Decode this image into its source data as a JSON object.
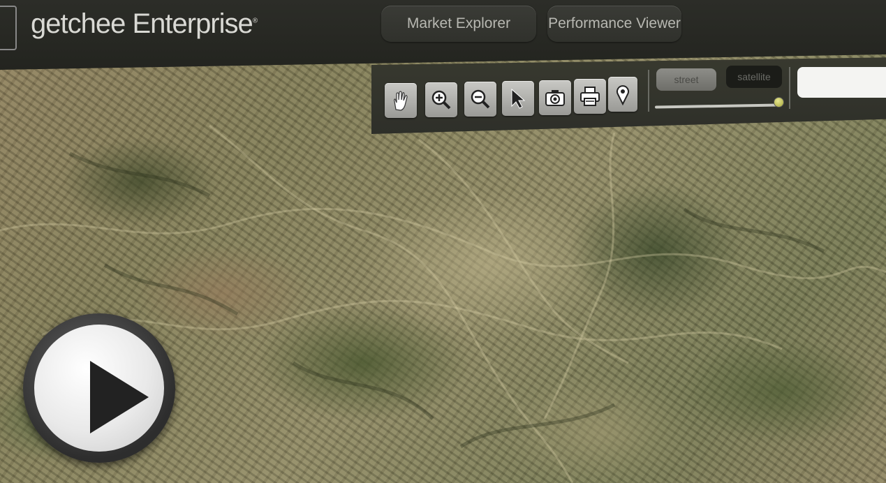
{
  "header": {
    "brand": "getchee Enterprise",
    "brand_mark": "®",
    "nav": [
      {
        "label": "Market Explorer"
      },
      {
        "label": "Performance Viewer"
      }
    ]
  },
  "toolbar": {
    "tools": [
      {
        "icon": "hand-pan-icon"
      },
      {
        "icon": "zoom-in-icon"
      },
      {
        "icon": "zoom-out-icon"
      },
      {
        "icon": "pointer-select-icon"
      },
      {
        "icon": "camera-icon"
      },
      {
        "icon": "printer-icon"
      },
      {
        "icon": "map-pin-icon"
      }
    ],
    "map_type": {
      "street_label": "street",
      "satellite_label": "satellite",
      "selected": "satellite"
    },
    "opacity_slider": {
      "value_fraction": 1.0
    },
    "search": {
      "value": "",
      "placeholder": ""
    }
  },
  "video": {
    "play_icon": "play-icon"
  },
  "colors": {
    "header_bg": "#2c2d28",
    "button_text": "#b8b8b2",
    "tool_bg": "#b4b4b0",
    "slider_thumb": "#c8c860"
  }
}
